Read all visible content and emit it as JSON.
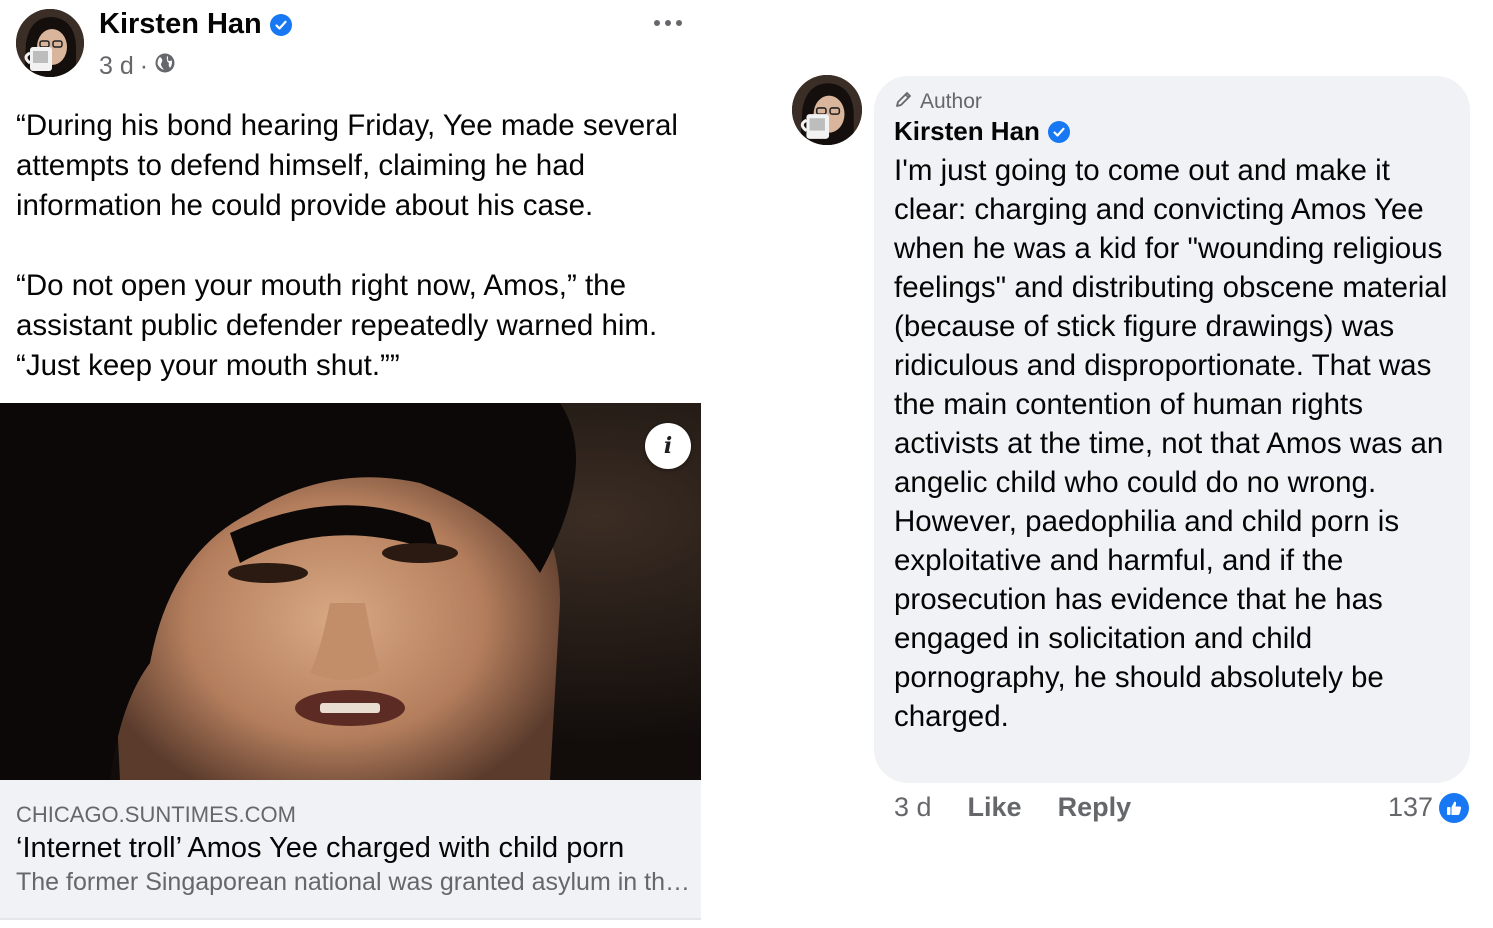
{
  "post": {
    "author": "Kirsten Han",
    "time": "3 d",
    "separator": "·",
    "privacy_icon": "globe-icon",
    "text": "“During his bond hearing Friday, Yee made several attempts to defend himself, claiming he had information he could provide about his case.\n\n“Do not open your mouth right now, Amos,” the assistant public defender repeatedly warned him. “Just keep your mouth shut.””",
    "link": {
      "info_glyph": "i",
      "domain": "CHICAGO.SUNTIMES.COM",
      "title": "‘Internet troll’ Amos Yee charged with child porn",
      "description": "The former Singaporean national was granted asylum in the United States"
    }
  },
  "comment": {
    "badge": "Author",
    "badge_icon": "pencil-icon",
    "author": "Kirsten Han",
    "text": "I'm just going to come out and make it clear: charging and convicting Amos Yee when he was a kid for \"wounding religious feelings\" and distributing obscene material (because of stick figure drawings) was ridiculous and disproportionate. That was the main contention of human rights activists at the time, not that Amos was an angelic child who could do no wrong. However, paedophilia and child porn is exploitative and harmful, and if the prosecution has evidence that he has engaged in solicitation and child pornography, he should absolutely be charged.",
    "time": "3 d",
    "like_label": "Like",
    "reply_label": "Reply",
    "reaction_count": "137"
  },
  "colors": {
    "accent": "#1877f2",
    "secondary_text": "#65676b",
    "bubble_bg": "#f0f2f5"
  }
}
